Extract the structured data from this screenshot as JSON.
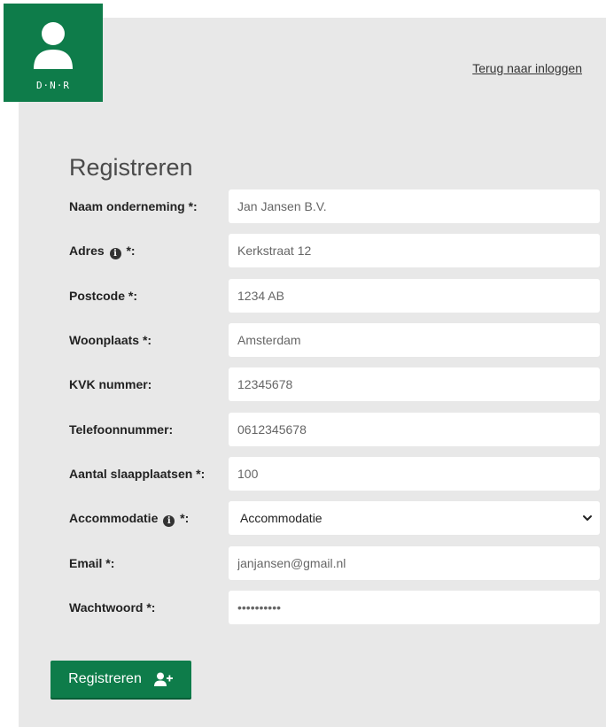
{
  "logo": {
    "text": "D·N·R"
  },
  "header": {
    "back_link": "Terug naar inloggen"
  },
  "form": {
    "title": "Registreren",
    "fields": [
      {
        "label": "Naam onderneming *:",
        "value": "Jan Jansen B.V."
      },
      {
        "label_main": "Adres",
        "label_suffix": "*:",
        "info_icon": "i",
        "value": "Kerkstraat 12"
      },
      {
        "label": "Postcode *:",
        "value": "1234 AB"
      },
      {
        "label": "Woonplaats *:",
        "value": "Amsterdam"
      },
      {
        "label": "KVK nummer:",
        "value": "12345678"
      },
      {
        "label": "Telefoonnummer:",
        "value": "0612345678"
      },
      {
        "label": "Aantal slaapplaatsen *:",
        "value": "100"
      },
      {
        "label_main": "Accommodatie",
        "label_suffix": "*:",
        "info_icon": "i",
        "selected": "Accommodatie"
      },
      {
        "label": "Email *:",
        "value": "janjansen@gmail.nl"
      },
      {
        "label": "Wachtwoord *:",
        "value": "1234567890"
      }
    ],
    "submit_label": "Registreren"
  },
  "colors": {
    "brand_green": "#0e7c4a",
    "panel_bg": "#e8e8e8"
  },
  "icons": {
    "logo": "user-silhouette-icon",
    "info": "info-icon",
    "submit": "user-plus-icon",
    "select": "chevron-down-icon"
  }
}
